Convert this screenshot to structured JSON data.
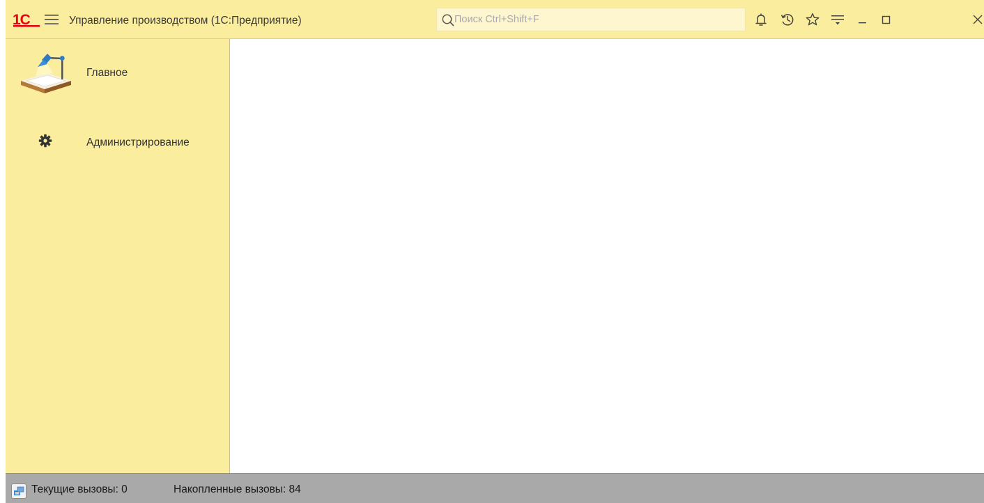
{
  "titlebar": {
    "logo_text": "1С",
    "app_title": "Управление производством  (1С:Предприятие)",
    "search": {
      "placeholder": "Поиск Ctrl+Shift+F",
      "value": ""
    },
    "buttons": [
      {
        "name": "notifications",
        "icon": "bell-icon"
      },
      {
        "name": "history",
        "icon": "history-icon"
      },
      {
        "name": "favorites",
        "icon": "star-icon"
      },
      {
        "name": "functions-menu",
        "icon": "filter-menu-icon"
      },
      {
        "name": "minimize",
        "icon": "minimize-icon"
      },
      {
        "name": "maximize",
        "icon": "maximize-icon"
      },
      {
        "name": "close",
        "icon": "close-icon"
      }
    ]
  },
  "sidebar": {
    "items": [
      {
        "label": "Главное",
        "icon": "desk-lamp-icon"
      },
      {
        "label": "Администрирование",
        "icon": "gear-icon"
      }
    ]
  },
  "statusbar": {
    "current_calls": "Текущие вызовы: 0",
    "accumulated_calls": "Накопленные вызовы: 84",
    "icon": "server-calls-icon"
  },
  "colors": {
    "panel_background": "#fbed9e",
    "search_background": "#fdf6cf",
    "statusbar_background": "#a9a9a9",
    "logo_red": "#e30613",
    "content_background": "#ffffff"
  }
}
